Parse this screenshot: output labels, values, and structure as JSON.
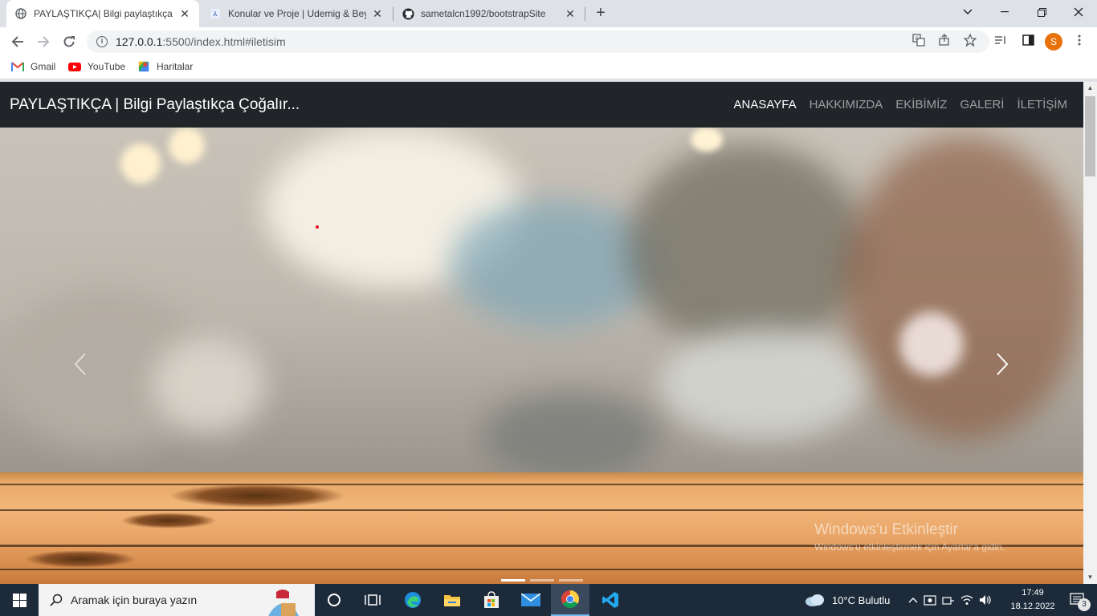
{
  "browser": {
    "tabs": [
      {
        "title": "PAYLAŞTIKÇA| Bilgi paylaştıkça ço",
        "active": true
      },
      {
        "title": "Konular ve Proje | Udemig & Bey",
        "active": false
      },
      {
        "title": "sametalcn1992/bootstrapSite",
        "active": false
      }
    ],
    "address": {
      "host": "127.0.0.1",
      "rest": ":5500/index.html#iletisim"
    },
    "profile_initial": "S",
    "bookmarks": [
      "Gmail",
      "YouTube",
      "Haritalar"
    ]
  },
  "site": {
    "brand": "PAYLAŞTIKÇA | Bilgi Paylaştıkça Çoğalır...",
    "menu": [
      "ANASAYFA",
      "HAKKIMIZDA",
      "EKİBİMİZ",
      "GALERİ",
      "İLETİŞİM"
    ],
    "active_menu_index": 0,
    "carousel": {
      "slides": 3,
      "active_slide": 1
    }
  },
  "watermark": {
    "title": "Windows'u Etkinleştir",
    "subtitle": "Windows'u etkinleştirmek için Ayarlar'a gidin."
  },
  "taskbar": {
    "search_placeholder": "Aramak için buraya yazın",
    "weather": "10°C  Bulutlu",
    "time": "17:49",
    "date": "18.12.2022",
    "notifications": "3"
  },
  "colors": {
    "navbar": "#212529",
    "taskbar": "#1c2a3a",
    "profile": "#e8710a"
  }
}
